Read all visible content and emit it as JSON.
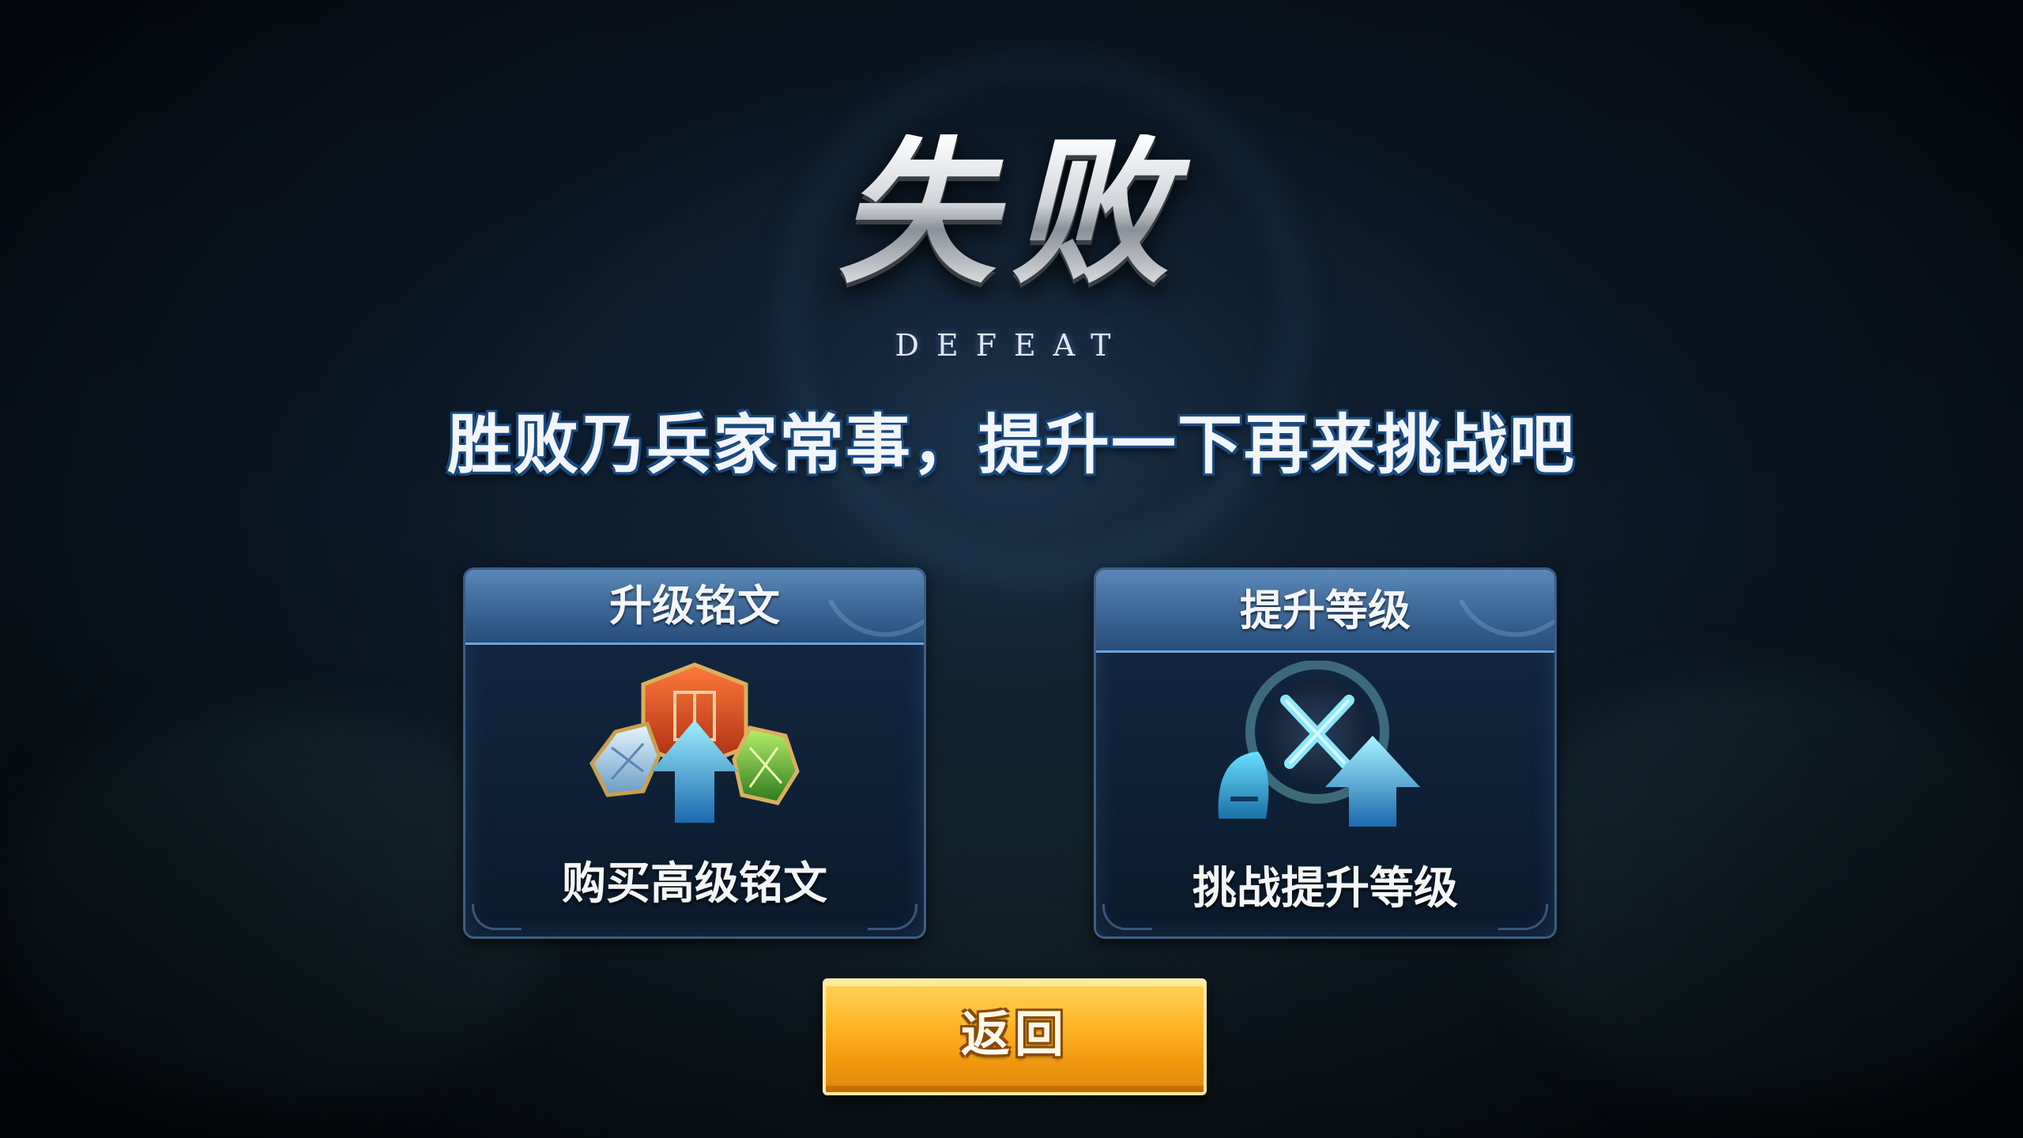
{
  "result": {
    "title": "失败",
    "title_en": "DEFEAT",
    "tagline": "胜败乃兵家常事，提升一下再来挑战吧"
  },
  "cards": [
    {
      "header": "升级铭文",
      "label": "购买高级铭文",
      "icon": "inscription-upgrade-icon"
    },
    {
      "header": "提升等级",
      "label": "挑战提升等级",
      "icon": "level-up-icon"
    }
  ],
  "return_button": {
    "label": "返回"
  },
  "colors": {
    "accent_blue": "#3d6898",
    "button_gold": "#ffb526",
    "background": "#0b1624"
  }
}
